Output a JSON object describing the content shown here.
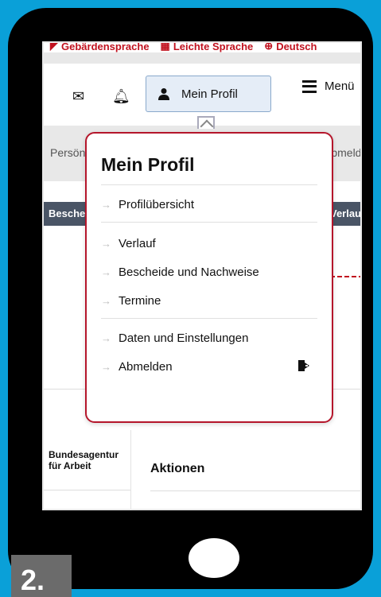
{
  "topbar": {
    "items": [
      "Gebärdensprache",
      "Leichte Sprache",
      "Deutsch"
    ]
  },
  "nav": {
    "profile_label": "Mein Profil",
    "menu_label": "Menü"
  },
  "background": {
    "tab_left": "Persönliche Daten",
    "tab_right": "Abmelden",
    "dark_left": "Bescheide",
    "dark_right": "Verlauf",
    "agency_line1": "Bundesagentur",
    "agency_line2": "für Arbeit",
    "actions_heading": "Aktionen"
  },
  "dropdown": {
    "title": "Mein Profil",
    "groups": [
      [
        "Profilübersicht"
      ],
      [
        "Verlauf",
        "Bescheide und Nachweise",
        "Termine"
      ],
      [
        "Daten und Einstellungen",
        "Abmelden"
      ]
    ]
  },
  "step_badge": "2.",
  "colors": {
    "background": "#0aa0d8",
    "phone": "#000000",
    "accent_red": "#b5162b",
    "profile_button_bg": "#e5edf7",
    "dark_bar": "#4a5566"
  }
}
